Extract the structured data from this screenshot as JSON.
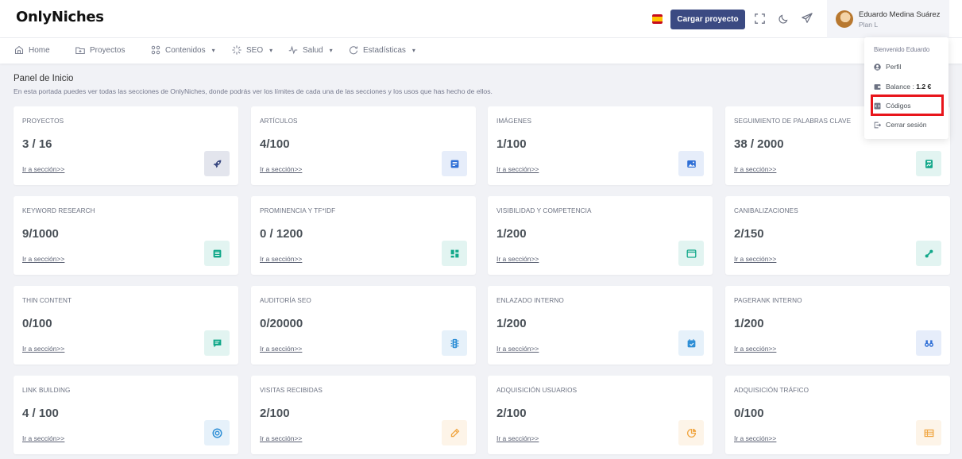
{
  "app": {
    "logo": "OnlyNiches"
  },
  "header": {
    "upload_button": "Cargar proyecto",
    "user": {
      "name": "Eduardo Medina Suárez",
      "plan": "Plan L"
    },
    "icons": [
      "spain-flag-icon",
      "fullscreen-icon",
      "moon-icon",
      "telegram-icon"
    ]
  },
  "nav": [
    {
      "label": "Home",
      "icon": "home-icon",
      "dropdown": false
    },
    {
      "label": "Proyectos",
      "icon": "folder-icon",
      "dropdown": false
    },
    {
      "label": "Contenidos",
      "icon": "apps-icon",
      "dropdown": true
    },
    {
      "label": "SEO",
      "icon": "loader-icon",
      "dropdown": true
    },
    {
      "label": "Salud",
      "icon": "pulse-icon",
      "dropdown": true
    },
    {
      "label": "Estadísticas",
      "icon": "refresh-icon",
      "dropdown": true
    }
  ],
  "page": {
    "title": "Panel de Inicio",
    "description": "En esta portada puedes ver todas las secciones de OnlyNiches, donde podrás ver los límites de cada una de las secciones y los usos que has hecho de ellos."
  },
  "cards": [
    {
      "label": "PROYECTOS",
      "value": "3 / 16",
      "link": "Ir a sección>>",
      "icon": "rocket-icon",
      "accent": "#3b4a82"
    },
    {
      "label": "ARTÍCULOS",
      "value": "4/100",
      "link": "Ir a sección>>",
      "icon": "article-icon",
      "accent": "#2f6fd6"
    },
    {
      "label": "IMÁGENES",
      "value": "1/100",
      "link": "Ir a sección>>",
      "icon": "image-icon",
      "accent": "#2f6fd6"
    },
    {
      "label": "SEGUIMIENTO DE PALABRAS CLAVE",
      "value": "38 / 2000",
      "link": "Ir a sección>>",
      "icon": "book-icon",
      "accent": "#12a88a"
    },
    {
      "label": "KEYWORD RESEARCH",
      "value": "9/1000",
      "link": "Ir a sección>>",
      "icon": "list-icon",
      "accent": "#12a88a"
    },
    {
      "label": "PROMINENCIA Y TF*IDF",
      "value": "0 / 1200",
      "link": "Ir a sección>>",
      "icon": "dashboard-icon",
      "accent": "#12a88a"
    },
    {
      "label": "VISIBILIDAD Y COMPETENCIA",
      "value": "1/200",
      "link": "Ir a sección>>",
      "icon": "browser-icon",
      "accent": "#12a88a"
    },
    {
      "label": "CANIBALIZACIONES",
      "value": "2/150",
      "link": "Ir a sección>>",
      "icon": "link-icon",
      "accent": "#12a88a"
    },
    {
      "label": "THIN CONTENT",
      "value": "0/100",
      "link": "Ir a sección>>",
      "icon": "comment-icon",
      "accent": "#12a88a"
    },
    {
      "label": "AUDITORÍA SEO",
      "value": "0/20000",
      "link": "Ir a sección>>",
      "icon": "traffic-light-icon",
      "accent": "#2f8fd6"
    },
    {
      "label": "ENLAZADO INTERNO",
      "value": "1/200",
      "link": "Ir a sección>>",
      "icon": "calendar-check-icon",
      "accent": "#2f8fd6"
    },
    {
      "label": "PAGERANK INTERNO",
      "value": "1/200",
      "link": "Ir a sección>>",
      "icon": "binoculars-icon",
      "accent": "#2f6fd6"
    },
    {
      "label": "LINK BUILDING",
      "value": "4 / 100",
      "link": "Ir a sección>>",
      "icon": "target-icon",
      "accent": "#2f8fd6"
    },
    {
      "label": "VISITAS RECIBIDAS",
      "value": "2/100",
      "link": "Ir a sección>>",
      "icon": "pencil-icon",
      "accent": "#f0a540"
    },
    {
      "label": "ADQUISICIÓN USUARIOS",
      "value": "2/100",
      "link": "Ir a sección>>",
      "icon": "pie-chart-icon",
      "accent": "#f0a540"
    },
    {
      "label": "ADQUISICIÓN TRÁFICO",
      "value": "0/100",
      "link": "Ir a sección>>",
      "icon": "table-icon",
      "accent": "#f0a540"
    }
  ],
  "dropdown": {
    "welcome": "Bienvenido Eduardo",
    "items": [
      {
        "label": "Perfil",
        "icon": "user-circle-icon"
      },
      {
        "label": "Balance : ",
        "value": "1.2 €",
        "icon": "wallet-icon"
      },
      {
        "label": "Códigos",
        "icon": "code-icon",
        "highlighted": true
      },
      {
        "label": "Cerrar sesión",
        "icon": "logout-icon"
      }
    ]
  }
}
